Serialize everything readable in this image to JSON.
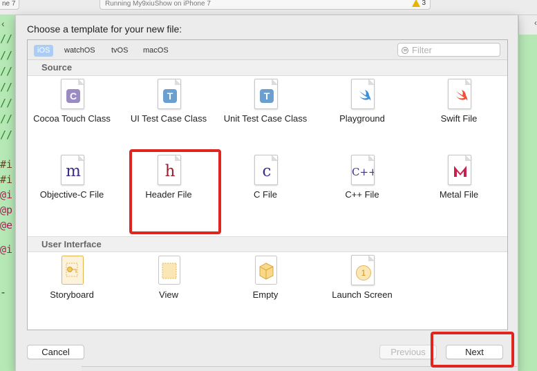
{
  "toolbar": {
    "scheme_text": "ne 7",
    "activity_text": "Running My9xiuShow on iPhone 7",
    "warning_count": "3"
  },
  "code_fragments": {
    "comment_lines": [
      "//",
      "//",
      "//",
      "//",
      "//",
      "//",
      "//"
    ],
    "directive_lines": [
      "#i",
      "#i",
      "@i",
      "@p",
      "@e"
    ],
    "impl_line": "@i",
    "dash": "-"
  },
  "sheet": {
    "title": "Choose a template for your new file:",
    "platforms": [
      "iOS",
      "watchOS",
      "tvOS",
      "macOS"
    ],
    "selected_platform": "iOS",
    "filter_placeholder": "Filter",
    "filter_value": "",
    "sections": {
      "source": {
        "label": "Source",
        "templates": [
          {
            "label": "Cocoa Touch Class",
            "icon": "cocoa-touch-class-icon",
            "glyph": "C"
          },
          {
            "label": "UI Test Case Class",
            "icon": "ui-test-case-class-icon",
            "glyph": "T"
          },
          {
            "label": "Unit Test Case Class",
            "icon": "unit-test-case-class-icon",
            "glyph": "T"
          },
          {
            "label": "Playground",
            "icon": "playground-icon"
          },
          {
            "label": "Swift File",
            "icon": "swift-file-icon"
          },
          {
            "label": "Objective-C File",
            "icon": "objective-c-file-icon",
            "glyph": "m"
          },
          {
            "label": "Header File",
            "icon": "header-file-icon",
            "glyph": "h"
          },
          {
            "label": "C File",
            "icon": "c-file-icon",
            "glyph": "c"
          },
          {
            "label": "C++ File",
            "icon": "cpp-file-icon",
            "glyph": "C++"
          },
          {
            "label": "Metal File",
            "icon": "metal-file-icon"
          }
        ]
      },
      "user_interface": {
        "label": "User Interface",
        "templates": [
          {
            "label": "Storyboard",
            "icon": "storyboard-icon"
          },
          {
            "label": "View",
            "icon": "view-icon"
          },
          {
            "label": "Empty",
            "icon": "empty-icon"
          },
          {
            "label": "Launch Screen",
            "icon": "launch-screen-icon",
            "glyph": "1"
          }
        ]
      }
    },
    "buttons": {
      "cancel": "Cancel",
      "previous": "Previous",
      "next": "Next"
    }
  },
  "colors": {
    "highlight": "#e0251f",
    "editor_bg": "#b6e8b6",
    "platform_selected": "#aacdf6"
  }
}
